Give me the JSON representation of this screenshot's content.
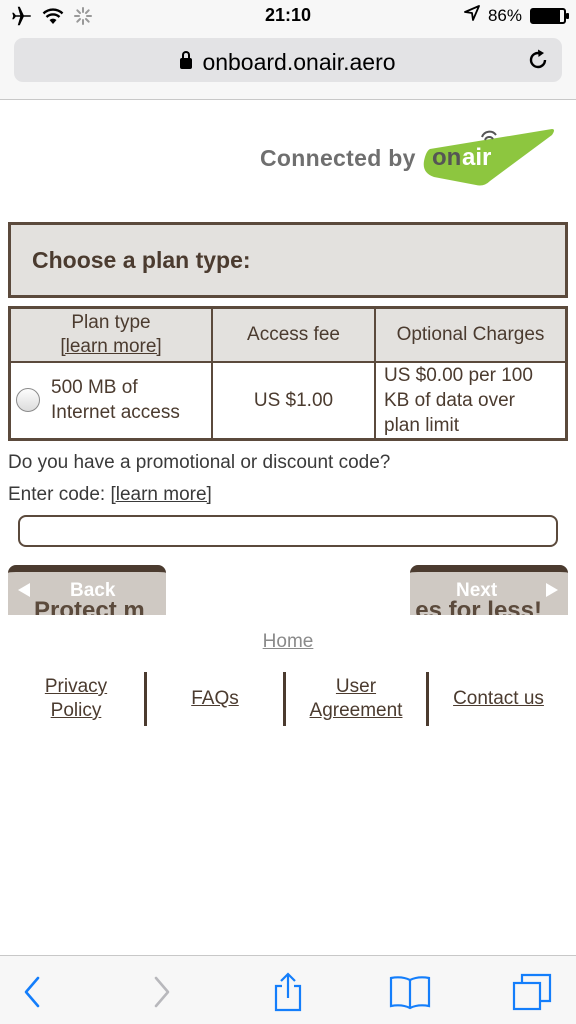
{
  "status_bar": {
    "time": "21:10",
    "battery_percent": "86%",
    "battery_level": 0.86
  },
  "browser": {
    "url": "onboard.onair.aero"
  },
  "logo": {
    "text": "Connected by",
    "brand": "onair",
    "brand_color": "#8dc63f"
  },
  "plan": {
    "header": "Choose a plan type:",
    "columns": {
      "plan_type": "Plan type",
      "plan_type_link": "[learn more]",
      "access_fee": "Access fee",
      "optional_charges": "Optional Charges"
    },
    "rows": [
      {
        "name_line1": "500 MB of",
        "name_line2": "Internet access",
        "fee": "US $1.00",
        "optional_line1": "US $0.00 per 100",
        "optional_line2": "KB of data over",
        "optional_line3": "plan limit"
      }
    ]
  },
  "promo": {
    "question": "Do you have a promotional or discount code?",
    "enter_label": "Enter code:",
    "learn_more": "[learn more]",
    "input_value": ""
  },
  "nav": {
    "back_label": "Back",
    "next_label": "Next",
    "back_bg_text": "Protect m",
    "next_bg_text": "es for less!"
  },
  "footer": {
    "home": "Home",
    "privacy_line1": "Privacy",
    "privacy_line2": "Policy",
    "faqs": "FAQs",
    "user_agreement_line1": "User",
    "user_agreement_line2": "Agreement",
    "contact": "Contact us"
  },
  "toolbar": {
    "icons": [
      "back-icon",
      "forward-icon",
      "share-icon",
      "bookmarks-icon",
      "tabs-icon"
    ],
    "accent": "#147efb"
  }
}
